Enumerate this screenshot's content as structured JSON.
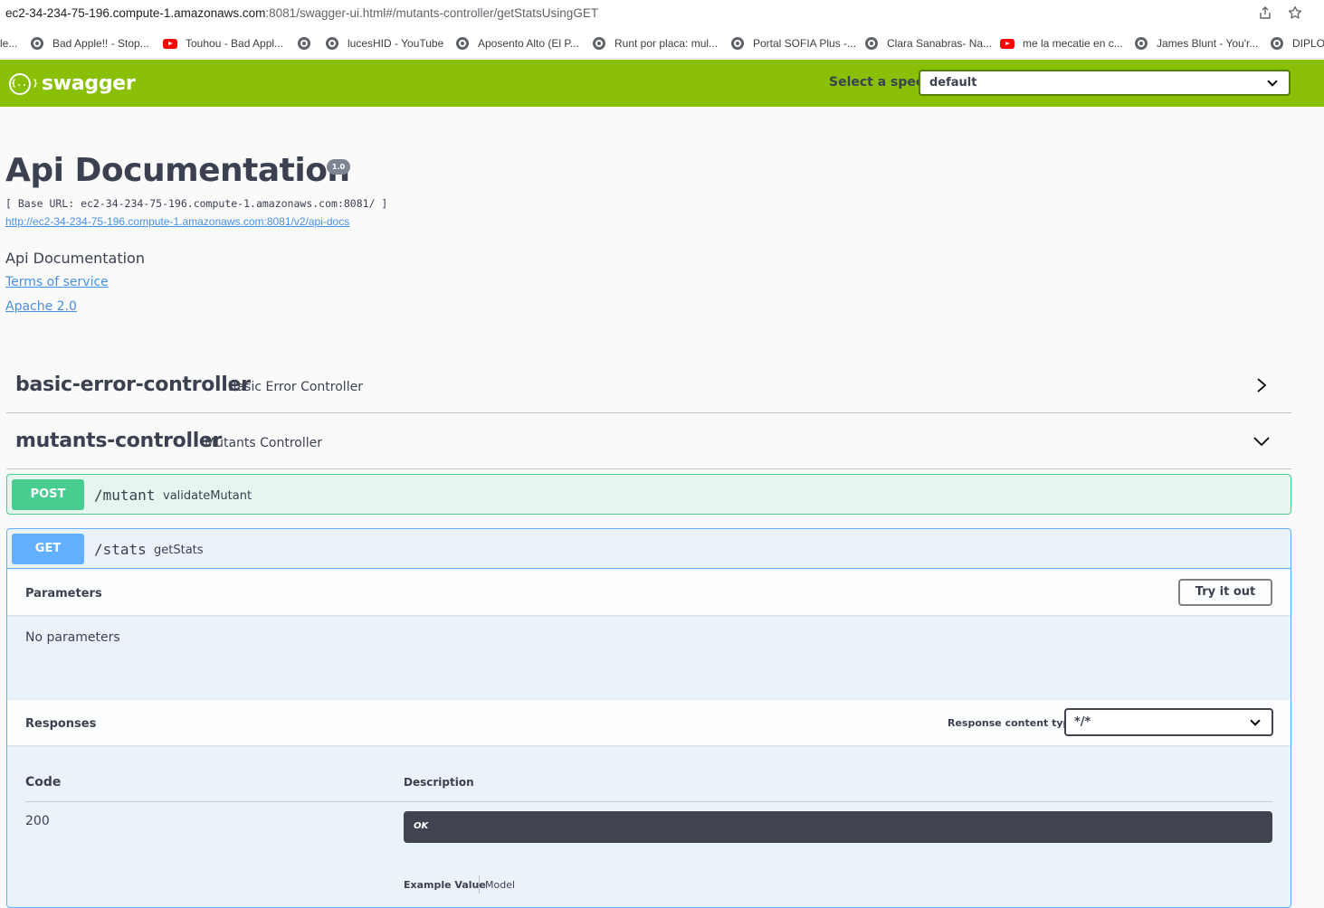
{
  "browser": {
    "url_host": "ec2-34-234-75-196.compute-1.amazonaws.com",
    "url_rest": ":8081/swagger-ui.html#/mutants-controller/getStatsUsingGET",
    "share_icon": "share-icon",
    "star_icon": "star-icon",
    "bookmarks": [
      {
        "label": "le...",
        "icon": "none"
      },
      {
        "label": "Bad Apple!! - Stop...",
        "icon": "globe-icon"
      },
      {
        "label": "Touhou - Bad Appl...",
        "icon": "youtube-icon"
      },
      {
        "label": "",
        "icon": "globe-icon"
      },
      {
        "label": "lucesHID - YouTube",
        "icon": "globe-icon"
      },
      {
        "label": "Aposento Alto (El P...",
        "icon": "globe-icon"
      },
      {
        "label": "Runt por placa: mul...",
        "icon": "globe-icon"
      },
      {
        "label": "Portal SOFIA Plus -...",
        "icon": "globe-icon"
      },
      {
        "label": "Clara Sanabras- Na...",
        "icon": "globe-icon"
      },
      {
        "label": "me la mecatie en c...",
        "icon": "youtube-icon"
      },
      {
        "label": "James Blunt - You'r...",
        "icon": "globe-icon"
      },
      {
        "label": "DIPLOI",
        "icon": "globe-icon"
      }
    ]
  },
  "topbar": {
    "logo_symbol": "{...}",
    "logo_text": "swagger",
    "spec_label": "Select a spec",
    "spec_value": "default",
    "accent_color": "#89bf04"
  },
  "info": {
    "title": "Api Documentation",
    "version": "1.0",
    "base_url": "[ Base URL: ec2-34-234-75-196.compute-1.amazonaws.com:8081/ ]",
    "api_docs_link": "http://ec2-34-234-75-196.compute-1.amazonaws.com:8081/v2/api-docs",
    "description": "Api Documentation",
    "terms_link": "Terms of service",
    "license_link": "Apache 2.0"
  },
  "tags": [
    {
      "name": "basic-error-controller",
      "description": "Basic Error Controller",
      "expanded": false
    },
    {
      "name": "mutants-controller",
      "description": "Mutants Controller",
      "expanded": true
    }
  ],
  "operations": {
    "post": {
      "method": "POST",
      "path": "/mutant",
      "summary": "validateMutant",
      "color": "#49cc90"
    },
    "get": {
      "method": "GET",
      "path": "/stats",
      "summary": "getStats",
      "color": "#61affe"
    }
  },
  "get_details": {
    "parameters_title": "Parameters",
    "try_it_out": "Try it out",
    "no_parameters": "No parameters",
    "responses_title": "Responses",
    "response_content_type_label": "Response content type",
    "response_content_type_value": "*/*",
    "col_code": "Code",
    "col_description": "Description",
    "responses": [
      {
        "code": "200",
        "description": "OK"
      }
    ],
    "tab_example": "Example Value",
    "tab_model": "Model"
  }
}
